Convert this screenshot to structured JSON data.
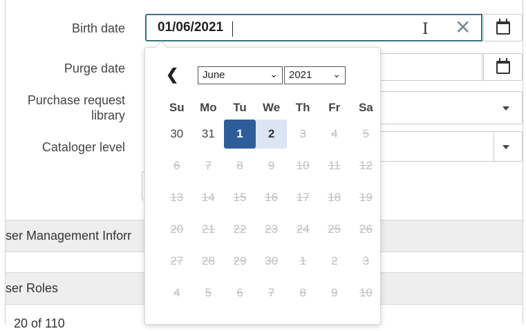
{
  "form": {
    "birth_date_label": "Birth date",
    "birth_date_value": "01/06/2021",
    "purge_date_label": "Purge date",
    "purchase_request_label_line1": "Purchase request",
    "purchase_request_label_line2": "library",
    "cataloger_level_label": "Cataloger level"
  },
  "sections": [
    {
      "label": "ser Management Inforr"
    },
    {
      "label": "ser Roles"
    }
  ],
  "pager": {
    "text": "20 of 110"
  },
  "icons": {
    "clear": "close-icon",
    "calendar": "calendar-icon",
    "dropdown": "chevron-down-icon",
    "prev": "chevron-left-icon",
    "cursor": "text-cursor-icon"
  },
  "datepicker": {
    "prev_symbol": "❮",
    "month_selected": "June",
    "year_selected": "2021",
    "dropdown_chevron": "⌄",
    "weekdays": [
      "Su",
      "Mo",
      "Tu",
      "We",
      "Th",
      "Fr",
      "Sa"
    ],
    "weeks": [
      [
        {
          "d": "30",
          "s": "active"
        },
        {
          "d": "31",
          "s": "active"
        },
        {
          "d": "1",
          "s": "selected"
        },
        {
          "d": "2",
          "s": "hover"
        },
        {
          "d": "3",
          "s": "disabled"
        },
        {
          "d": "4",
          "s": "disabled"
        },
        {
          "d": "5",
          "s": "disabled"
        }
      ],
      [
        {
          "d": "6",
          "s": "disabled"
        },
        {
          "d": "7",
          "s": "disabled"
        },
        {
          "d": "8",
          "s": "disabled"
        },
        {
          "d": "9",
          "s": "disabled"
        },
        {
          "d": "10",
          "s": "disabled"
        },
        {
          "d": "11",
          "s": "disabled"
        },
        {
          "d": "12",
          "s": "disabled"
        }
      ],
      [
        {
          "d": "13",
          "s": "disabled"
        },
        {
          "d": "14",
          "s": "disabled"
        },
        {
          "d": "15",
          "s": "disabled"
        },
        {
          "d": "16",
          "s": "disabled"
        },
        {
          "d": "17",
          "s": "disabled"
        },
        {
          "d": "18",
          "s": "disabled"
        },
        {
          "d": "19",
          "s": "disabled"
        }
      ],
      [
        {
          "d": "20",
          "s": "disabled"
        },
        {
          "d": "21",
          "s": "disabled"
        },
        {
          "d": "22",
          "s": "disabled"
        },
        {
          "d": "23",
          "s": "disabled"
        },
        {
          "d": "24",
          "s": "disabled"
        },
        {
          "d": "25",
          "s": "disabled"
        },
        {
          "d": "26",
          "s": "disabled"
        }
      ],
      [
        {
          "d": "27",
          "s": "disabled"
        },
        {
          "d": "28",
          "s": "disabled"
        },
        {
          "d": "29",
          "s": "disabled"
        },
        {
          "d": "30",
          "s": "disabled"
        },
        {
          "d": "1",
          "s": "disabled"
        },
        {
          "d": "2",
          "s": "disabled"
        },
        {
          "d": "3",
          "s": "disabled"
        }
      ],
      [
        {
          "d": "4",
          "s": "disabled"
        },
        {
          "d": "5",
          "s": "disabled"
        },
        {
          "d": "6",
          "s": "disabled"
        },
        {
          "d": "7",
          "s": "disabled"
        },
        {
          "d": "8",
          "s": "disabled"
        },
        {
          "d": "9",
          "s": "disabled"
        },
        {
          "d": "10",
          "s": "disabled"
        }
      ]
    ]
  },
  "colors": {
    "focus_border": "#3a6f7d",
    "selected_day_bg": "#2e5e9a",
    "hover_day_bg": "#dde4f3",
    "disabled_day": "#c0c0c0",
    "section_bg": "#eeeeee"
  }
}
